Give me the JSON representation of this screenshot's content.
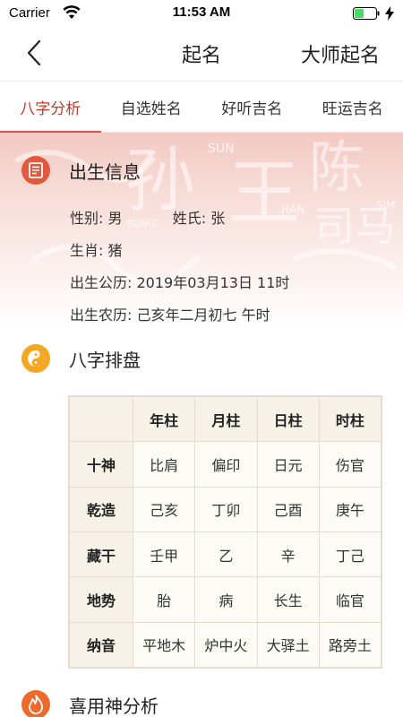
{
  "status": {
    "carrier": "Carrier",
    "time": "11:53 AM"
  },
  "nav": {
    "title": "起名",
    "right": "大师起名"
  },
  "tabs": [
    {
      "label": "八字分析",
      "active": true
    },
    {
      "label": "自选姓名",
      "active": false
    },
    {
      "label": "好听吉名",
      "active": false
    },
    {
      "label": "旺运吉名",
      "active": false
    }
  ],
  "birth_info": {
    "title": "出生信息",
    "gender_label": "性别:",
    "gender": "男",
    "surname_label": "姓氏:",
    "surname": "张",
    "zodiac_label": "生肖:",
    "zodiac": "猪",
    "solar_label": "出生公历:",
    "solar": "2019年03月13日 11时",
    "lunar_label": "出生农历:",
    "lunar": "己亥年二月初七 午时"
  },
  "bazi": {
    "title": "八字排盘",
    "columns": [
      "年柱",
      "月柱",
      "日柱",
      "时柱"
    ],
    "rows": [
      {
        "head": "十神",
        "cells": [
          "比肩",
          "偏印",
          "日元",
          "伤官"
        ]
      },
      {
        "head": "乾造",
        "cells": [
          "己亥",
          "丁卯",
          "己酉",
          "庚午"
        ]
      },
      {
        "head": "藏干",
        "cells": [
          "壬甲",
          "乙",
          "辛",
          "丁己"
        ]
      },
      {
        "head": "地势",
        "cells": [
          "胎",
          "病",
          "长生",
          "临官"
        ]
      },
      {
        "head": "纳音",
        "cells": [
          "平地木",
          "炉中火",
          "大驿土",
          "路旁土"
        ]
      }
    ]
  },
  "xiyong": {
    "title": "喜用神分析"
  },
  "banner_text": [
    "孙",
    "王",
    "陈",
    "司马",
    "SUN",
    "HAN",
    "KONG",
    "SIM"
  ],
  "colors": {
    "accent": "#d9534f",
    "icon_red": "#e4583e",
    "icon_orange": "#f5a623",
    "icon_fire": "#ee6a2c"
  }
}
